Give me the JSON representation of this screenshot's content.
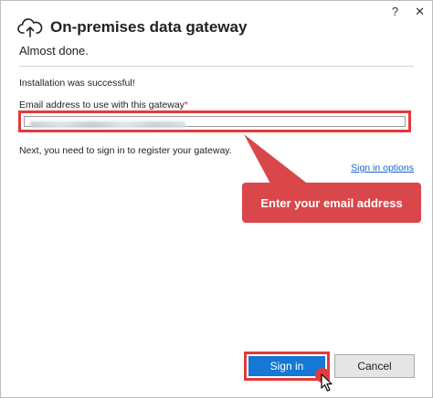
{
  "window": {
    "help_label": "?",
    "close_label": "✕"
  },
  "app": {
    "icon": "cloud-upload-icon",
    "title": "On-premises data gateway",
    "subtitle": "Almost done."
  },
  "main": {
    "success_message": "Installation was successful!",
    "email_label": "Email address to use with this gateway",
    "email_required_marker": "*",
    "email_value": "",
    "next_message": "Next, you need to sign in to register your gateway.",
    "signin_options_link": "Sign in options"
  },
  "callout": {
    "text": "Enter your email address",
    "color": "#d9474b"
  },
  "buttons": {
    "signin_label": "Sign in",
    "cancel_label": "Cancel"
  },
  "colors": {
    "accent": "#1478d4",
    "highlight": "#e23b3b",
    "link": "#1a63c7"
  }
}
